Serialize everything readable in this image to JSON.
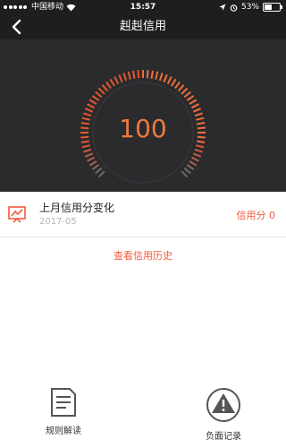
{
  "status_bar": {
    "carrier": "中国移动",
    "time": "15:57",
    "battery": "53%",
    "battery_level": 0.53
  },
  "nav": {
    "title": "赳赳信用"
  },
  "gauge": {
    "score": "100"
  },
  "credit_row": {
    "title": "上月信用分变化",
    "date": "2017-05",
    "score_text": "信用分 0"
  },
  "history_link": "查看信用历史",
  "bottom": {
    "rules_label": "规则解读",
    "negative_label": "负面记录"
  },
  "colors": {
    "accent": "#f25a3c",
    "dark": "#2b2b2e"
  }
}
